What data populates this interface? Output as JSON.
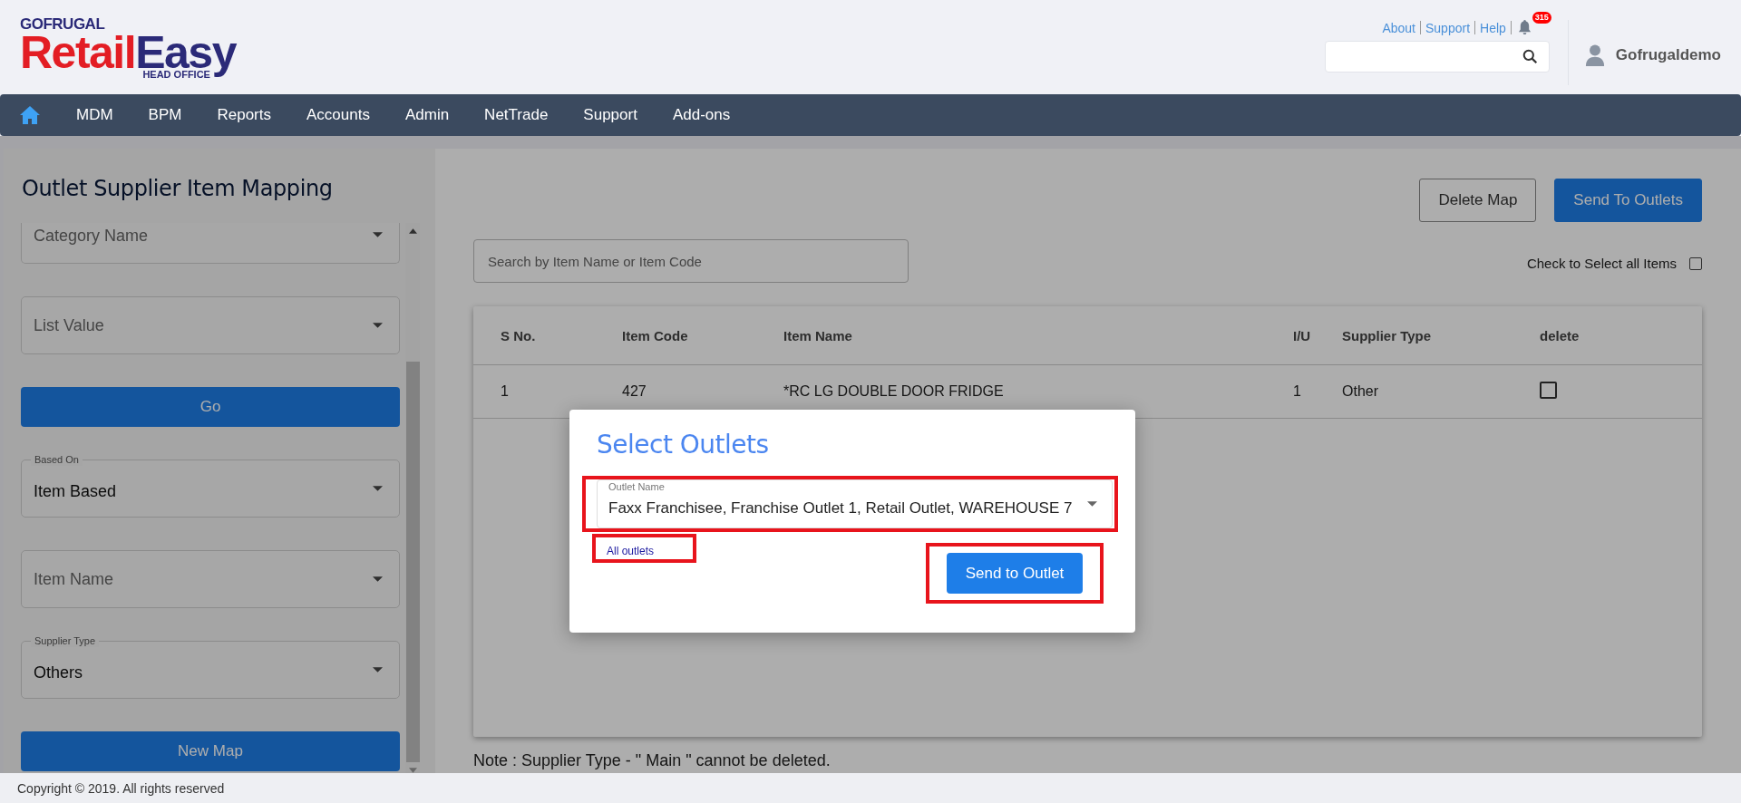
{
  "logo": {
    "brand": "GOFRUGAL",
    "product_first": "Retail",
    "product_second": "Easy",
    "edition": "HEAD OFFICE"
  },
  "top_links": [
    "About",
    "Support",
    "Help"
  ],
  "notifications": {
    "count": "315"
  },
  "user": {
    "name": "Gofrugaldemo"
  },
  "nav": [
    "MDM",
    "BPM",
    "Reports",
    "Accounts",
    "Admin",
    "NetTrade",
    "Support",
    "Add-ons"
  ],
  "sidebar": {
    "title": "Outlet Supplier Item Mapping",
    "controls": [
      {
        "kind": "select",
        "label": "Category Name"
      },
      {
        "kind": "select",
        "label": "List Value"
      },
      {
        "kind": "button",
        "label": "Go"
      },
      {
        "kind": "select",
        "label": "Based On",
        "value": "Item Based"
      },
      {
        "kind": "select",
        "label": "Item Name"
      },
      {
        "kind": "select",
        "label": "Supplier Type",
        "value": "Others"
      },
      {
        "kind": "button",
        "label": "New Map"
      }
    ]
  },
  "actions": [
    "Delete Map",
    "Send To Outlets"
  ],
  "search": {
    "placeholder": "Search by Item Name or Item Code"
  },
  "select_all": {
    "label": "Check to Select all Items",
    "checked": false
  },
  "table": {
    "columns": [
      "S No.",
      "Item Code",
      "Item Name",
      "I/U",
      "Supplier Type",
      "delete"
    ],
    "rows": [
      {
        "s_no": "1",
        "item_code": "427",
        "item_name": "*RC LG DOUBLE DOOR FRIDGE",
        "iu": "1",
        "supplier_type": "Other",
        "delete_checked": false
      }
    ]
  },
  "note": "Note : Supplier Type - \" Main \" cannot be deleted.",
  "dialog": {
    "title": "Select Outlets",
    "field_label": "Outlet Name",
    "field_value": "Faxx Franchisee, Franchise Outlet 1, Retail Outlet, WAREHOUSE 7",
    "link": "All outlets",
    "button": "Send to Outlet"
  },
  "footer": "Copyright © 2019. All rights reserved"
}
